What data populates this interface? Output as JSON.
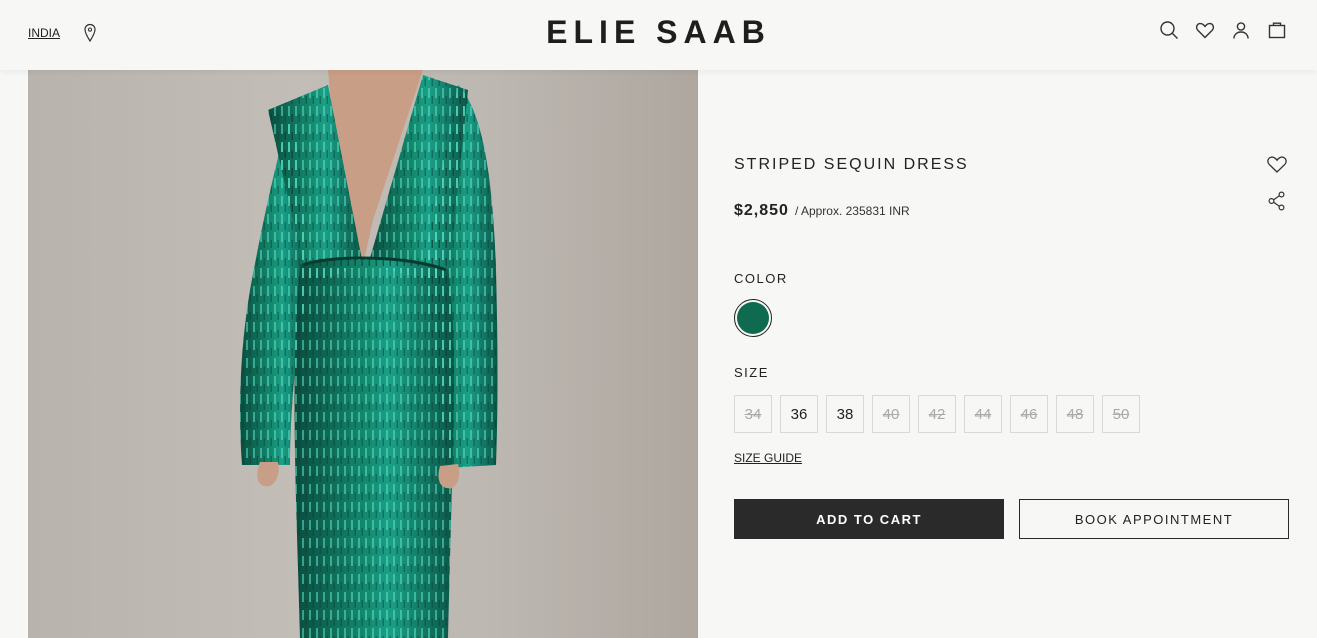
{
  "header": {
    "country": "INDIA",
    "logo": "ELIE SAAB",
    "icons": [
      "location-icon",
      "search-icon",
      "heart-icon",
      "user-icon",
      "bag-icon"
    ]
  },
  "product": {
    "title": "STRIPED SEQUIN DRESS",
    "price": "$2,850",
    "approx": "/ Approx. 235831 INR",
    "color_label": "COLOR",
    "color_swatch": "#0e6b4f",
    "size_label": "SIZE",
    "sizes": [
      {
        "label": "34",
        "available": false
      },
      {
        "label": "36",
        "available": true
      },
      {
        "label": "38",
        "available": true
      },
      {
        "label": "40",
        "available": false
      },
      {
        "label": "42",
        "available": false
      },
      {
        "label": "44",
        "available": false
      },
      {
        "label": "46",
        "available": false
      },
      {
        "label": "48",
        "available": false
      },
      {
        "label": "50",
        "available": false
      }
    ],
    "size_guide": "SIZE GUIDE",
    "add_to_cart": "ADD TO CART",
    "book_appointment": "BOOK APPOINTMENT"
  },
  "colors": {
    "dress": "#0d6a55",
    "dress_highlight": "#1fb39a",
    "button_dark": "#2a2a2a"
  }
}
